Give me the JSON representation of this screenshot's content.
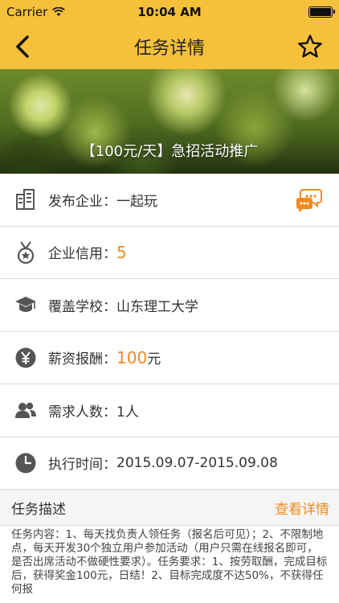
{
  "status": {
    "carrier": "Carrier",
    "time": "10:04 AM"
  },
  "nav": {
    "title": "任务详情"
  },
  "hero": {
    "caption": "【100元/天】急招活动推广"
  },
  "rows": {
    "company": {
      "label": "发布企业：",
      "value": "一起玩"
    },
    "credit": {
      "label": "企业信用：",
      "value": "5"
    },
    "school": {
      "label": "覆盖学校：",
      "value": "山东理工大学"
    },
    "salary": {
      "label": "薪资报酬：",
      "value": "100",
      "unit": "元"
    },
    "people": {
      "label": "需求人数：",
      "value": "1人"
    },
    "time": {
      "label": "执行时间：",
      "value": "2015.09.07-2015.09.08"
    }
  },
  "description": {
    "header": "任务描述",
    "more_link": "查看详情",
    "text": "任务内容：1、每天找负责人领任务（报名后可见）；2、不限制地点，每天开发30个独立用户参加活动（用户只需在线报名即可，是否出席活动不做硬性要求）。任务要求：1、按劳取酬，完成目标后，获得奖金100元，日结！2、目标完成度不达50%，不获得任何报"
  },
  "colors": {
    "brand": "#f5c03a",
    "accent": "#f28a1f"
  }
}
